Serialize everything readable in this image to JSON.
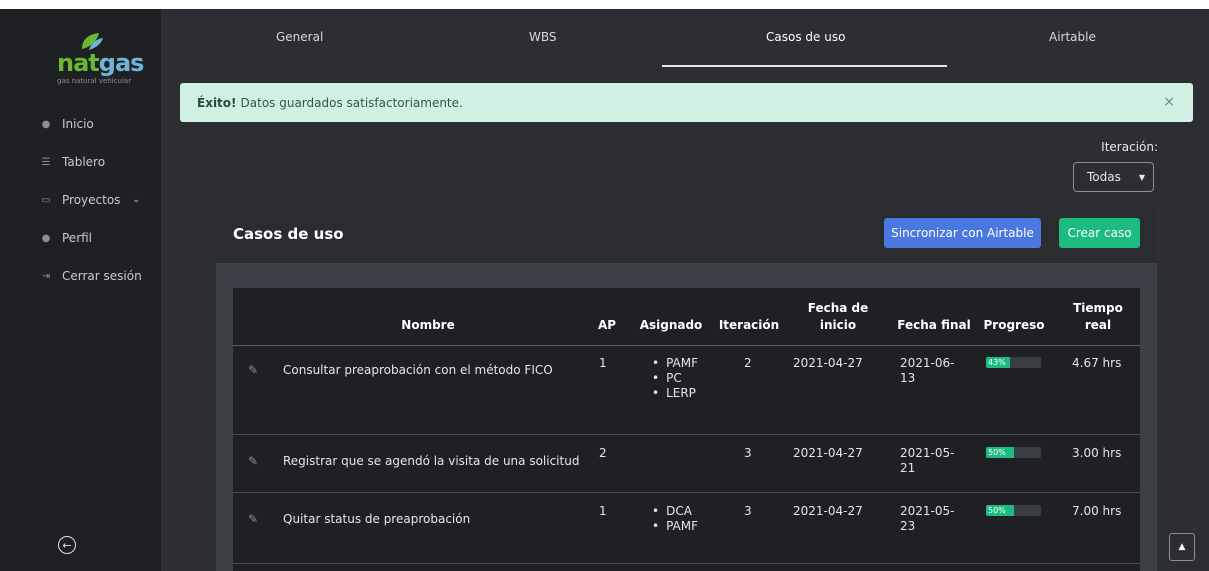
{
  "brand": {
    "name_part1": "nat",
    "name_part2": "gas",
    "tagline": "gas natural vehicular",
    "colors": {
      "green": "#69b935",
      "blue": "#6db6d8"
    }
  },
  "sidebar": {
    "items": [
      {
        "label": "Inicio",
        "icon": "palette-icon"
      },
      {
        "label": "Tablero",
        "icon": "list-icon"
      },
      {
        "label": "Proyectos",
        "icon": "folder-icon"
      },
      {
        "label": "Perfil",
        "icon": "user-icon"
      },
      {
        "label": "Cerrar sesión",
        "icon": "logout-icon"
      }
    ]
  },
  "tabs": [
    {
      "label": "General"
    },
    {
      "label": "WBS"
    },
    {
      "label": "Casos de uso",
      "active": true
    },
    {
      "label": "Airtable"
    }
  ],
  "alert": {
    "strong": "Éxito!",
    "message": "Datos guardados satisfactoriamente.",
    "close": "×"
  },
  "filter": {
    "label": "Iteración:",
    "value": "Todas"
  },
  "card": {
    "title": "Casos de uso",
    "sync_label": "Sincronizar con Airtable",
    "create_label": "Crear caso"
  },
  "table": {
    "headers": {
      "nombre": "Nombre",
      "ap": "AP",
      "asignado": "Asignado",
      "iteracion": "Iteración",
      "fecha_inicio_1": "Fecha de",
      "fecha_inicio_2": "inicio",
      "fecha_final": "Fecha final",
      "progreso": "Progreso",
      "tiempo_1": "Tiempo",
      "tiempo_2": "real"
    },
    "rows": [
      {
        "nombre": "Consultar preaprobación con el método FICO",
        "ap": "1",
        "asignado": [
          "PAMF",
          "PC",
          "LERP"
        ],
        "iteracion": "2",
        "inicio": "2021-04-27",
        "final_1": "2021-06-",
        "final_2": "13",
        "progreso": "43%",
        "progreso_value": 43,
        "tiempo": "4.67 hrs"
      },
      {
        "nombre": "Registrar que se agendó la visita de una solicitud",
        "ap": "2",
        "asignado": [],
        "iteracion": "3",
        "inicio": "2021-04-27",
        "final_1": "2021-05-",
        "final_2": "21",
        "progreso": "50%",
        "progreso_value": 50,
        "tiempo": "3.00 hrs"
      },
      {
        "nombre": "Quitar status de preaprobación",
        "ap": "1",
        "asignado": [
          "DCA",
          "PAMF"
        ],
        "iteracion": "3",
        "inicio": "2021-04-27",
        "final_1": "2021-05-",
        "final_2": "23",
        "progreso": "50%",
        "progreso_value": 50,
        "tiempo": "7.00 hrs"
      }
    ]
  },
  "colors": {
    "accent_blue": "#4a78e0",
    "accent_green": "#1cbc81",
    "alert_bg": "#d1f0e3"
  }
}
